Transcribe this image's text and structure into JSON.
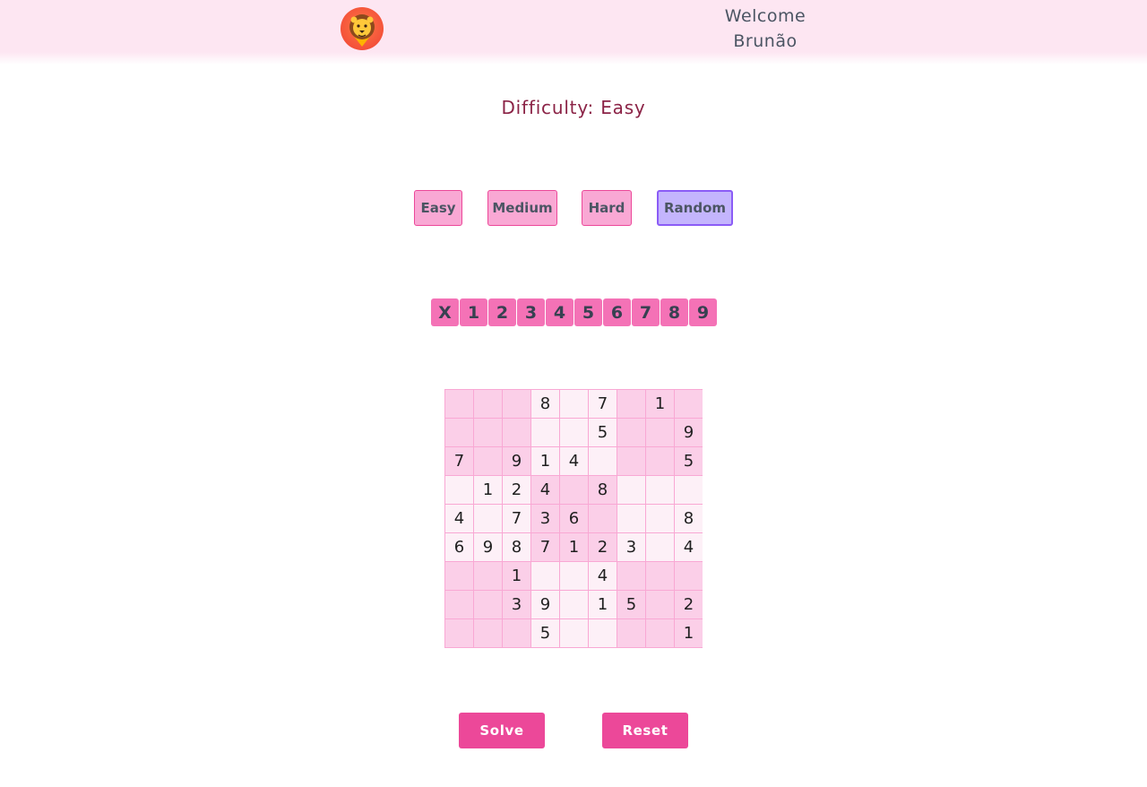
{
  "header": {
    "welcome_line1": "Welcome",
    "welcome_line2": "Brunão",
    "logo_icon": "lion-icon"
  },
  "difficulty": {
    "label": "Difficulty: Easy"
  },
  "difficulty_buttons": [
    {
      "label": "Easy"
    },
    {
      "label": "Medium"
    },
    {
      "label": "Hard"
    },
    {
      "label": "Random",
      "selected": true
    }
  ],
  "number_pad": [
    "X",
    "1",
    "2",
    "3",
    "4",
    "5",
    "6",
    "7",
    "8",
    "9"
  ],
  "board": [
    [
      "",
      "",
      "",
      "8",
      "",
      "7",
      "",
      "1",
      ""
    ],
    [
      "",
      "",
      "",
      "",
      "",
      "5",
      "",
      "",
      "9"
    ],
    [
      "7",
      "",
      "9",
      "1",
      "4",
      "",
      "",
      "",
      "5"
    ],
    [
      "",
      "1",
      "2",
      "4",
      "",
      "8",
      "",
      "",
      ""
    ],
    [
      "4",
      "",
      "7",
      "3",
      "6",
      "",
      "",
      "",
      "8"
    ],
    [
      "6",
      "9",
      "8",
      "7",
      "1",
      "2",
      "3",
      "",
      "4"
    ],
    [
      "",
      "",
      "1",
      "",
      "",
      "4",
      "",
      "",
      ""
    ],
    [
      "",
      "",
      "3",
      "9",
      "",
      "1",
      "5",
      "",
      "2"
    ],
    [
      "",
      "",
      "",
      "5",
      "",
      "",
      "",
      "",
      "1"
    ]
  ],
  "actions": {
    "solve_label": "Solve",
    "reset_label": "Reset"
  },
  "colors": {
    "header_bg": "#fde6f2",
    "accent": "#ec4899",
    "cell_dark": "#fbcfe8",
    "cell_light": "#fdf0f7",
    "random_bg": "#c4b5fd"
  }
}
